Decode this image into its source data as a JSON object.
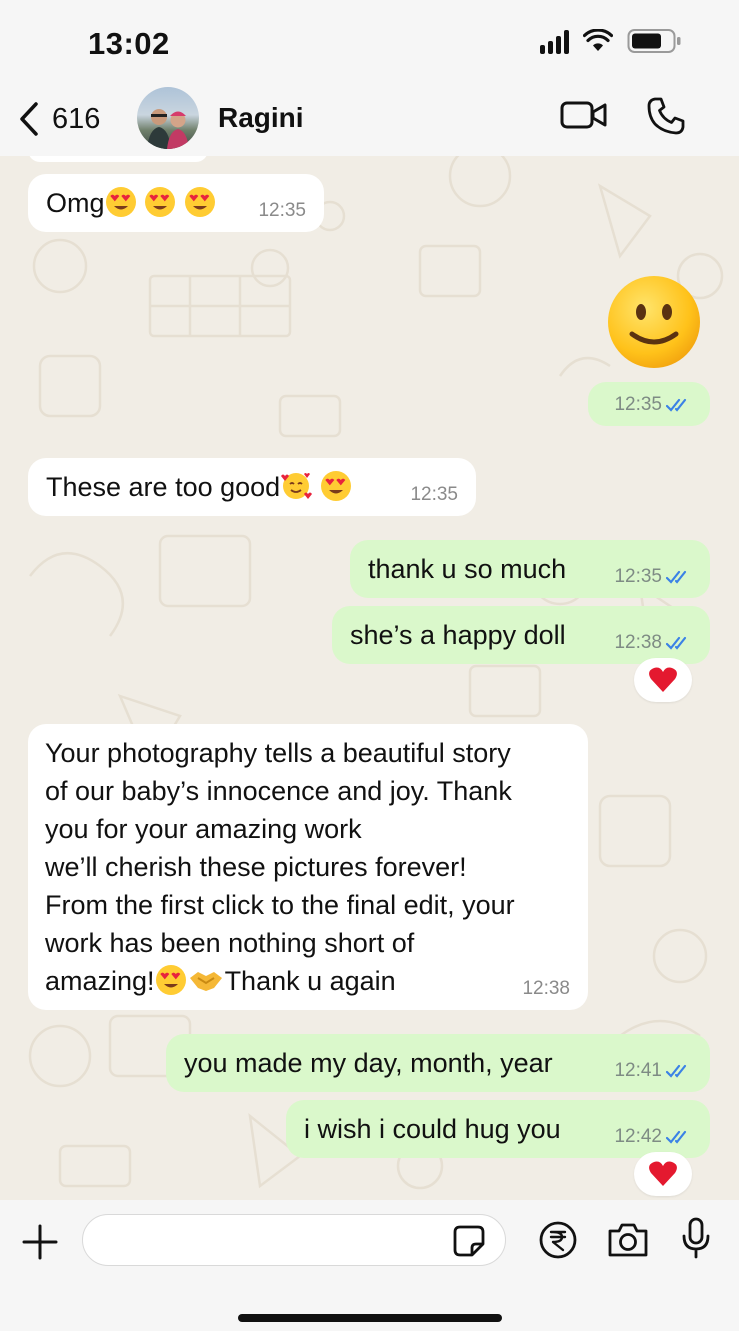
{
  "status_bar": {
    "time": "13:02"
  },
  "header": {
    "back_count": "616",
    "contact_name": "Ragini"
  },
  "messages": [
    {
      "direction": "in",
      "text": "Omg",
      "time": "12:35",
      "emojis": [
        "heart-eyes",
        "heart-eyes",
        "heart-eyes"
      ]
    },
    {
      "direction": "out",
      "emoji_only": "slightly-smiling-face",
      "time": "12:35",
      "status": "read"
    },
    {
      "direction": "in",
      "text": "These are too good",
      "time": "12:35",
      "emojis": [
        "smiling-face-with-hearts",
        "heart-eyes"
      ]
    },
    {
      "direction": "out",
      "text": "thank u so much",
      "time": "12:35",
      "status": "read"
    },
    {
      "direction": "out",
      "text": "she’s a happy doll",
      "time": "12:38",
      "status": "read",
      "reaction": "red-heart"
    },
    {
      "direction": "in",
      "lines": [
        "Your photography tells a beautiful story",
        "of our baby’s innocence and joy. Thank",
        "you for your amazing work",
        "we’ll cherish these pictures forever!",
        "From the first click to the final edit, your",
        "work has been nothing short of",
        "amazing!",
        "Thank u again"
      ],
      "time": "12:38",
      "emojis": [
        "heart-eyes",
        "handshake"
      ]
    },
    {
      "direction": "out",
      "text": "you made my day, month, year",
      "time": "12:41",
      "status": "read"
    },
    {
      "direction": "out",
      "text": "i wish i could hug you",
      "time": "12:42",
      "status": "read",
      "reaction": "red-heart"
    }
  ],
  "input_bar": {
    "placeholder": ""
  },
  "colors": {
    "outgoing_bubble": "#daf8cb",
    "incoming_bubble": "#ffffff",
    "chat_background": "#f1ede5",
    "read_tick": "#3b82e6"
  }
}
